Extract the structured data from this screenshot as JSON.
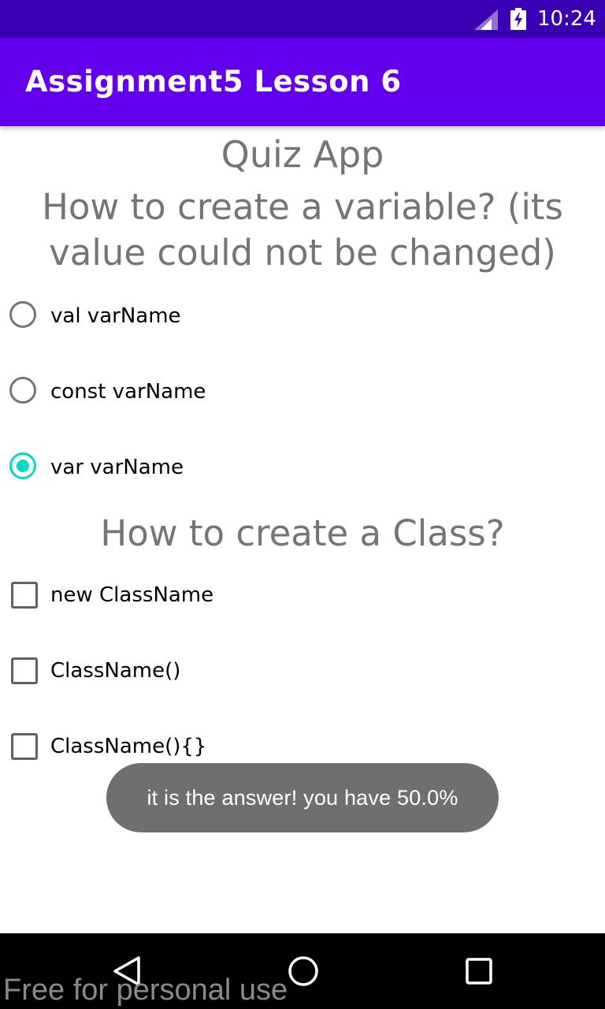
{
  "status_bar": {
    "time": "10:24",
    "icons": [
      "signal-icon",
      "battery-charging-icon"
    ],
    "background": "#3a00b3"
  },
  "app_bar": {
    "title": "Assignment5 Lesson 6",
    "background": "#6200ee"
  },
  "quiz": {
    "title": "Quiz App",
    "question1": {
      "text": "How to create a variable? (its value could not be changed)",
      "options": [
        {
          "label": "val varName",
          "checked": false
        },
        {
          "label": "const varName",
          "checked": false
        },
        {
          "label": "var varName",
          "checked": true
        }
      ]
    },
    "question2": {
      "text": "How to create a Class?",
      "options": [
        {
          "label": "new ClassName",
          "checked": false
        },
        {
          "label": "ClassName()",
          "checked": false
        },
        {
          "label": "ClassName(){}",
          "checked": false
        }
      ]
    },
    "accent_color": "#03dac5"
  },
  "toast": {
    "message": "it is the answer! you have 50.0%"
  },
  "nav_bar": {
    "icons": [
      "back-icon",
      "home-icon",
      "recents-icon"
    ]
  },
  "watermark": {
    "text": "Free for personal use"
  }
}
